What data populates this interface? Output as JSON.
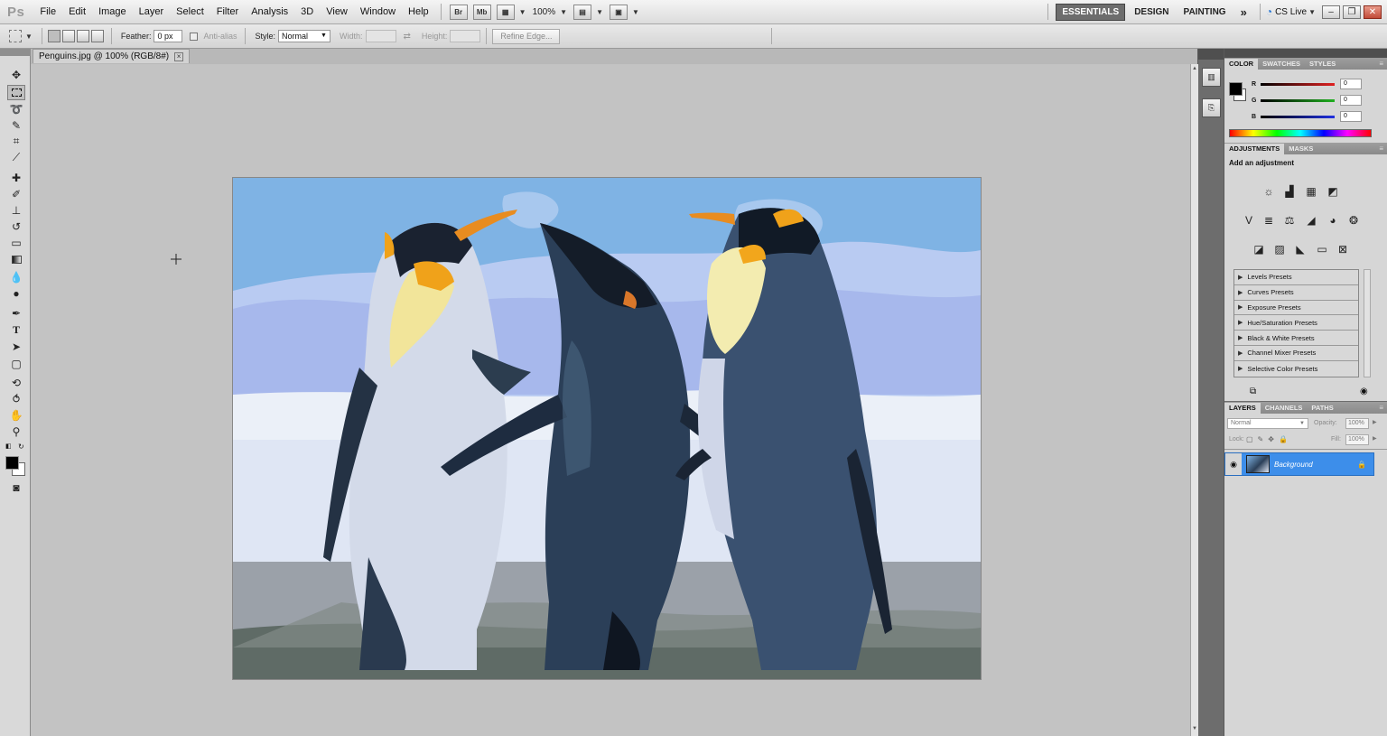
{
  "app": {
    "logo": "Ps",
    "menus": [
      "File",
      "Edit",
      "Image",
      "Layer",
      "Select",
      "Filter",
      "Analysis",
      "3D",
      "View",
      "Window",
      "Help"
    ],
    "app_bar": {
      "br_label": "Br",
      "mb_label": "Mb",
      "zoom": "100%"
    },
    "workspaces": [
      "ESSENTIALS",
      "DESIGN",
      "PAINTING"
    ],
    "more_label": "»",
    "cs_live": "CS Live"
  },
  "options": {
    "feather_label": "Feather:",
    "feather_value": "0 px",
    "antialias_label": "Anti-alias",
    "style_label": "Style:",
    "style_value": "Normal",
    "width_label": "Width:",
    "height_label": "Height:",
    "refine_edge": "Refine Edge..."
  },
  "document": {
    "tab_title": "Penguins.jpg @ 100% (RGB/8#)"
  },
  "color_panel": {
    "tabs": [
      "COLOR",
      "SWATCHES",
      "STYLES"
    ],
    "channels": [
      {
        "label": "R",
        "value": "0",
        "color": "#e02020"
      },
      {
        "label": "G",
        "value": "0",
        "color": "#20b020"
      },
      {
        "label": "B",
        "value": "0",
        "color": "#2030e0"
      }
    ],
    "foreground": "#000000",
    "background": "#ffffff"
  },
  "adjustments_panel": {
    "tabs": [
      "ADJUSTMENTS",
      "MASKS"
    ],
    "heading": "Add an adjustment",
    "presets": [
      "Levels Presets",
      "Curves Presets",
      "Exposure Presets",
      "Hue/Saturation Presets",
      "Black & White Presets",
      "Channel Mixer Presets",
      "Selective Color Presets"
    ]
  },
  "layers_panel": {
    "tabs": [
      "LAYERS",
      "CHANNELS",
      "PATHS"
    ],
    "blend_mode": "Normal",
    "opacity_label": "Opacity:",
    "opacity": "100%",
    "lock_label": "Lock:",
    "fill_label": "Fill:",
    "fill": "100%",
    "layers": [
      {
        "name": "Background"
      }
    ]
  },
  "colors": {
    "accent": "#3d8eea",
    "canvas_bg": "#c3c3c3",
    "panel_bg": "#d6d6d6",
    "dock_bg": "#6d6d6d"
  }
}
